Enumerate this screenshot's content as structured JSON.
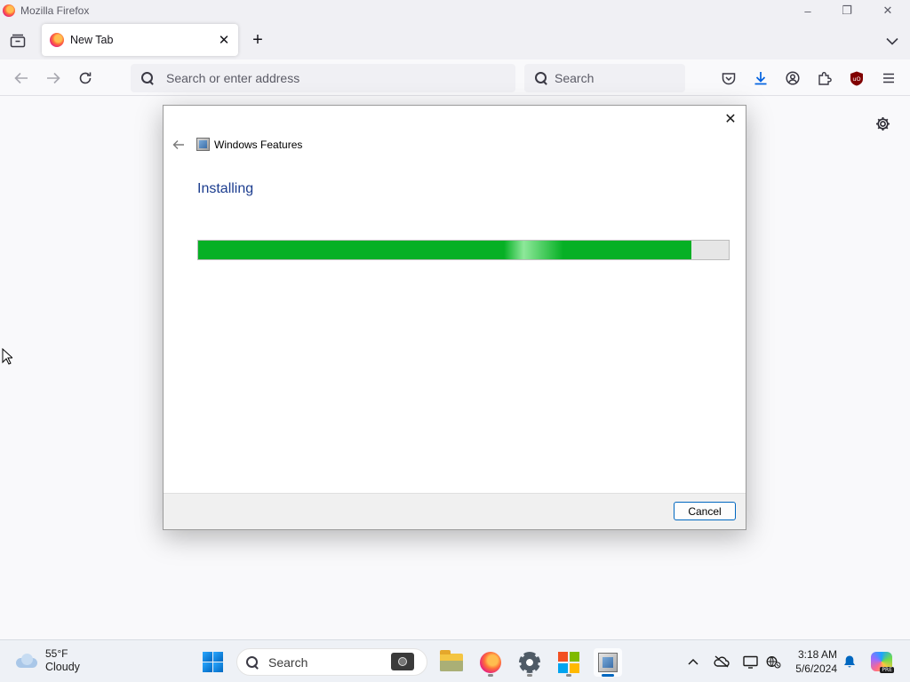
{
  "window": {
    "title": "Mozilla Firefox",
    "minimize": "–",
    "maximize": "❐",
    "close": "✕"
  },
  "tabs": [
    {
      "label": "New Tab",
      "close": "✕",
      "active": true
    }
  ],
  "tabstrip": {
    "new_tab": "+"
  },
  "navbar": {
    "url_placeholder": "Search or enter address",
    "search_placeholder": "Search"
  },
  "dialog": {
    "close": "✕",
    "app_title": "Windows Features",
    "heading": "Installing",
    "progress_fraction": 0.93,
    "cancel_label": "Cancel"
  },
  "taskbar": {
    "weather_temp": "55°F",
    "weather_condition": "Cloudy",
    "search_placeholder": "Search",
    "tray_chevron": "^",
    "time": "3:18 AM",
    "date": "5/6/2024",
    "copilot_badge": "PRE"
  },
  "colors": {
    "accent": "#0067c0",
    "progress_green": "#06b025",
    "heading_blue": "#1c3d8f"
  }
}
